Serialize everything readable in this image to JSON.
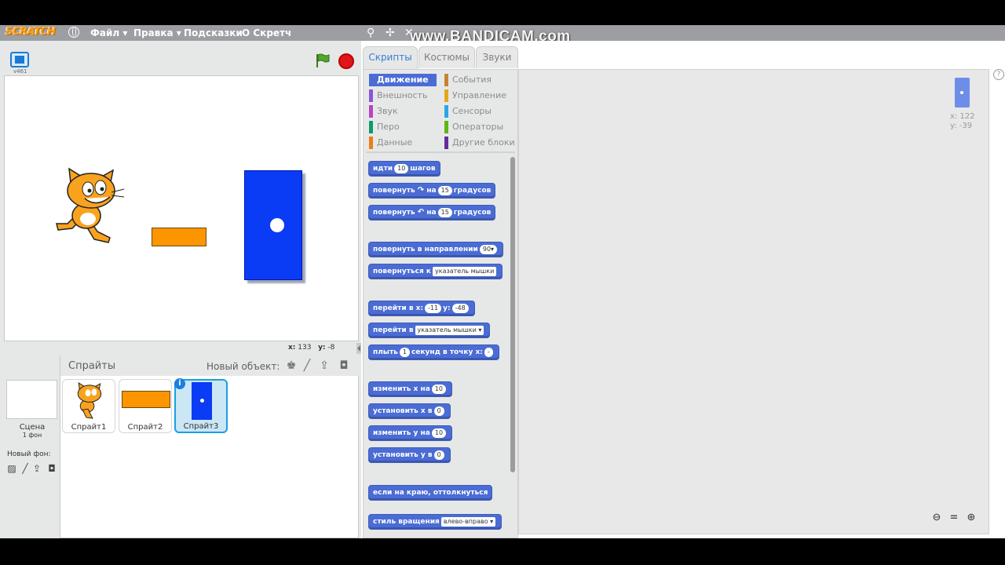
{
  "watermark": "www.BANDICAM.com",
  "menubar": {
    "logo": "SCRATCH",
    "file": "Файл ▾",
    "edit": "Правка ▾",
    "tips": "Подсказки",
    "about": "О Скретч"
  },
  "stage": {
    "version": "v461",
    "mouse_x_label": "x:",
    "mouse_x": "133",
    "mouse_y_label": "y:",
    "mouse_y": "-8"
  },
  "sprites_pane": {
    "title": "Спрайты",
    "new_object": "Новый объект:",
    "scene_label": "Сцена",
    "scene_sub": "1 фон",
    "new_backdrop": "Новый фон:",
    "sprites": [
      {
        "label": "Спрайт1"
      },
      {
        "label": "Спрайт2"
      },
      {
        "label": "Спрайт3"
      }
    ],
    "info_badge": "i"
  },
  "tabs": [
    "Скрипты",
    "Костюмы",
    "Звуки"
  ],
  "categories": [
    {
      "label": "Движение",
      "color": "#4a6cd4"
    },
    {
      "label": "События",
      "color": "#c88330"
    },
    {
      "label": "Внешность",
      "color": "#8a55d7"
    },
    {
      "label": "Управление",
      "color": "#e1a91a"
    },
    {
      "label": "Звук",
      "color": "#bb42c3"
    },
    {
      "label": "Сенсоры",
      "color": "#2ca5e2"
    },
    {
      "label": "Перо",
      "color": "#0e9a6c"
    },
    {
      "label": "Операторы",
      "color": "#5cb712"
    },
    {
      "label": "Данные",
      "color": "#ee7d16"
    },
    {
      "label": "Другие блоки",
      "color": "#632d99"
    }
  ],
  "blocks": {
    "move": {
      "pre": "идти",
      "v": "10",
      "post": "шагов"
    },
    "turn_right": {
      "pre": "повернуть",
      "icon": "↷",
      "mid": "на",
      "v": "15",
      "post": "градусов"
    },
    "turn_left": {
      "pre": "повернуть",
      "icon": "↶",
      "mid": "на",
      "v": "15",
      "post": "градусов"
    },
    "point_dir": {
      "pre": "повернуть в направлении",
      "v": "90▾"
    },
    "point_towards": {
      "pre": "повернуться к",
      "v": "указатель мышки"
    },
    "goto_xy": {
      "pre": "перейти в x:",
      "x": "-11",
      "mid": "y:",
      "y": "-48"
    },
    "goto": {
      "pre": "перейти в",
      "v": "указатель мышки ▾"
    },
    "glide": {
      "pre": "плыть",
      "v": "1",
      "mid": "секунд в точку x:",
      "x": "-"
    },
    "change_x": {
      "pre": "изменить х на",
      "v": "10"
    },
    "set_x": {
      "pre": "установить х в",
      "v": "0"
    },
    "change_y": {
      "pre": "изменить у на",
      "v": "10"
    },
    "set_y": {
      "pre": "установить у в",
      "v": "0"
    },
    "bounce": {
      "pre": "если на краю, оттолкнуться"
    },
    "rotation_style": {
      "pre": "стиль вращения",
      "v": "влево-вправо ▾"
    }
  },
  "scripts_area": {
    "sprite_x_label": "x:",
    "sprite_x": "122",
    "sprite_y_label": "y:",
    "sprite_y": "-39",
    "help": "?"
  }
}
